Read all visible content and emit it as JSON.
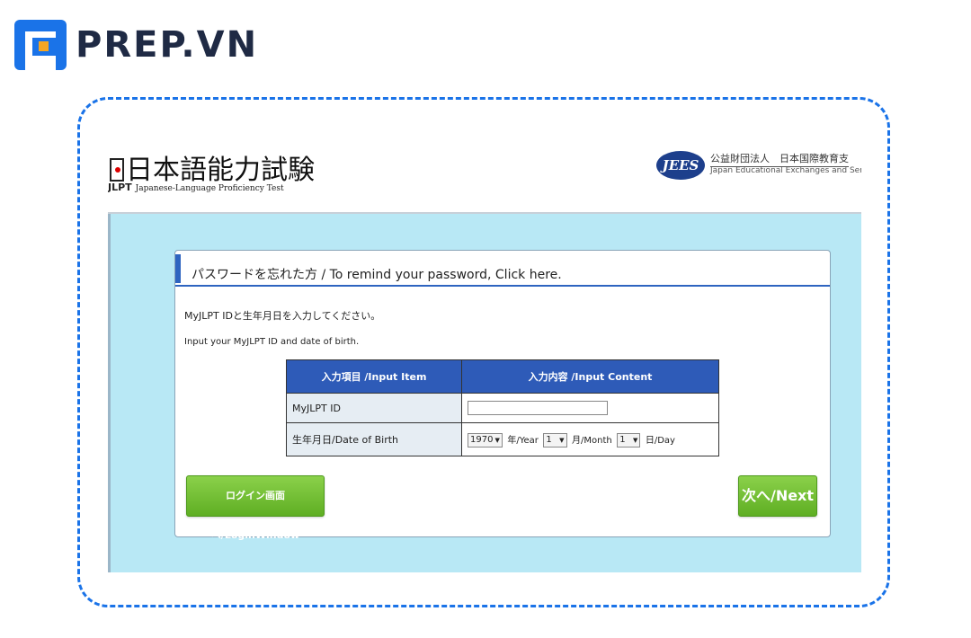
{
  "brand": {
    "name": "PREP.VN"
  },
  "jlpt": {
    "title": "日本語能力試験",
    "sub_logo": "JLPT",
    "sub_text": "Japanese-Language Proficiency Test",
    "org_logo": "JEES",
    "org_name_ja": "公益財団法人　日本国際教育支",
    "org_name_en": "Japan Educational Exchanges and Ser"
  },
  "card": {
    "title": "パスワードを忘れた方 / To remind your password, Click here.",
    "intro_ja": "MyJLPT IDと生年月日を入力してください。",
    "intro_en": "Input your MyJLPT ID and date of birth.",
    "table": {
      "headers": [
        "入力項目 /Input Item",
        "入力内容 /Input Content"
      ],
      "rows": [
        {
          "label": "MyJLPT ID",
          "value": ""
        },
        {
          "label": "生年月日/Date of Birth"
        }
      ]
    },
    "dob": {
      "year": "1970",
      "year_label": "年/Year",
      "month": "1",
      "month_label": "月/Month",
      "day": "1",
      "day_label": "日/Day"
    },
    "buttons": {
      "login": "ログイン画面へ/LoginWindow",
      "next": "次へ/Next"
    }
  },
  "colors": {
    "brand_blue": "#1a73e8",
    "brand_orange": "#f5a623",
    "body_bg": "#b8e8f5",
    "header_blue": "#2e5bb8",
    "button_green": "#6fbe30"
  }
}
